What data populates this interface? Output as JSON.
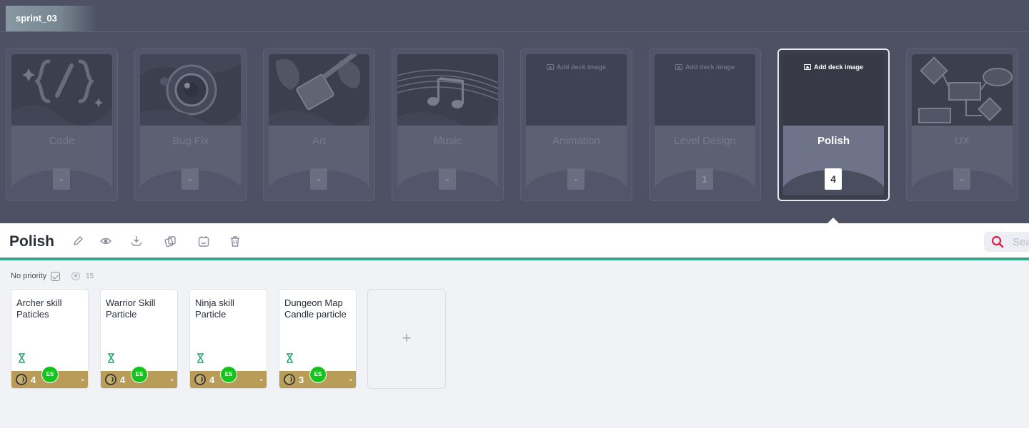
{
  "sprint": {
    "tab_label": "sprint_03"
  },
  "decks": [
    {
      "name": "Code",
      "count": "-",
      "art": "code-art"
    },
    {
      "name": "Bug Fix",
      "count": "-",
      "art": "eye-art"
    },
    {
      "name": "Art",
      "count": "-",
      "art": "paint-art"
    },
    {
      "name": "Music",
      "count": "-",
      "art": "music-art"
    },
    {
      "name": "Animation",
      "count": "-",
      "add_image_label": "Add deck image"
    },
    {
      "name": "Level Design",
      "count": "1",
      "add_image_label": "Add deck image"
    },
    {
      "name": "Polish",
      "count": "4",
      "add_image_label": "Add deck image",
      "active": true
    },
    {
      "name": "UX",
      "count": "-",
      "art": "flowchart-art"
    }
  ],
  "toolbar": {
    "title": "Polish",
    "tools": [
      "pencil-icon",
      "eye-icon",
      "download-icon",
      "cards-icon",
      "calendar-icon",
      "trash-icon"
    ],
    "search_placeholder": "Search"
  },
  "filter": {
    "label": "No priority",
    "points_total": "15"
  },
  "cards": [
    {
      "title": "Archer skill Paticles",
      "points": "4",
      "estimate": "-",
      "assignee": "ES"
    },
    {
      "title": "Warrior Skill Particle",
      "points": "4",
      "estimate": "-",
      "assignee": "ES"
    },
    {
      "title": "Ninja skill Particle",
      "points": "4",
      "estimate": "-",
      "assignee": "ES"
    },
    {
      "title": "Dungeon Map Candle particle",
      "points": "3",
      "estimate": "-",
      "assignee": "ES"
    }
  ],
  "add_card": {
    "label": "+"
  },
  "colors": {
    "top_bg": "#4e5164",
    "accent_green": "#36a688",
    "card_bar": "#b89c57",
    "avatar_green": "#14c41c",
    "search_red": "#e11d48"
  }
}
